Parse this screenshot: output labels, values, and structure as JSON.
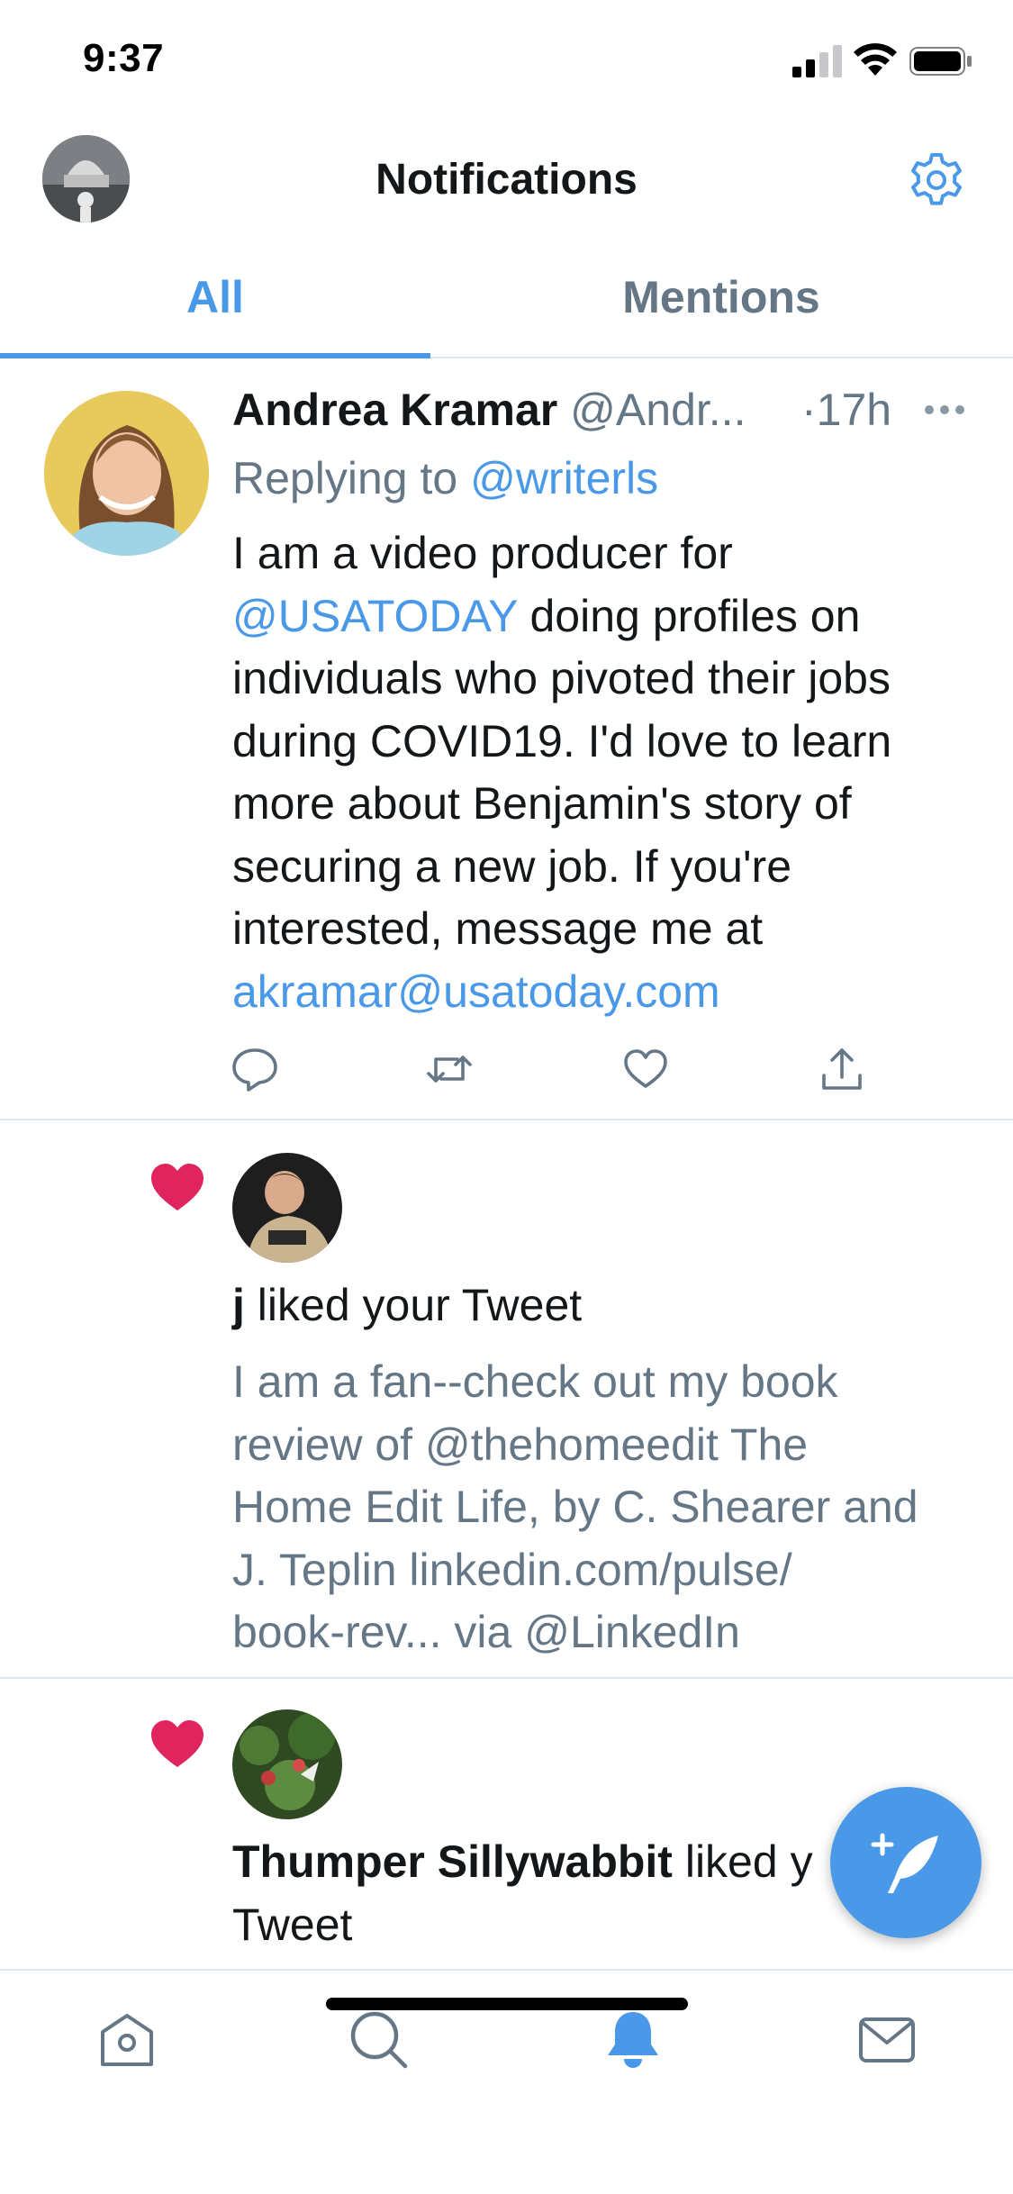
{
  "status_bar": {
    "time": "9:37"
  },
  "header": {
    "title": "Notifications",
    "avatar": "profile-avatar",
    "settings_icon": "gear-icon"
  },
  "tabs": [
    {
      "label": "All",
      "active": true
    },
    {
      "label": "Mentions",
      "active": false
    }
  ],
  "tweet": {
    "author_name": "Andrea Kramar",
    "author_handle": "@Andr...",
    "time": "·17h",
    "reply_prefix": "Replying to",
    "reply_to": "@writerls",
    "body": {
      "l1": "I am a video producer for",
      "l2_link": "@USATODAY",
      "l2_rest": " doing profiles on",
      "l3": "individuals who pivoted their jobs",
      "l4": "during COVID19. I'd love to learn",
      "l5": "more about Benjamin's story of",
      "l6": "securing a new job. If you're",
      "l7": "interested, message me at",
      "l8_link": "akramar@usatoday.com"
    },
    "actions": [
      "reply-icon",
      "retweet-icon",
      "like-icon",
      "share-icon"
    ]
  },
  "notifications": [
    {
      "type": "like",
      "user": "j",
      "action_text": " liked your Tweet",
      "tweet_lines": [
        "I am a fan--check out my book",
        "review of @thehomeedit The",
        "Home Edit Life, by C. Shearer and",
        "J. Teplin linkedin.com/pulse/",
        "book-rev... via @LinkedIn"
      ]
    },
    {
      "type": "like",
      "user": "Thumper Sillywabbit",
      "action_text_l1": " liked y",
      "action_text_l2": "Tweet"
    }
  ],
  "tab_bar": {
    "items": [
      "home-icon",
      "search-icon",
      "notifications-bell-icon",
      "messages-icon"
    ],
    "active": "notifications-bell-icon"
  },
  "colors": {
    "accent": "#4a99e9",
    "secondary_text": "#657786",
    "like": "#e0245e",
    "divider": "#e1e8ed"
  }
}
